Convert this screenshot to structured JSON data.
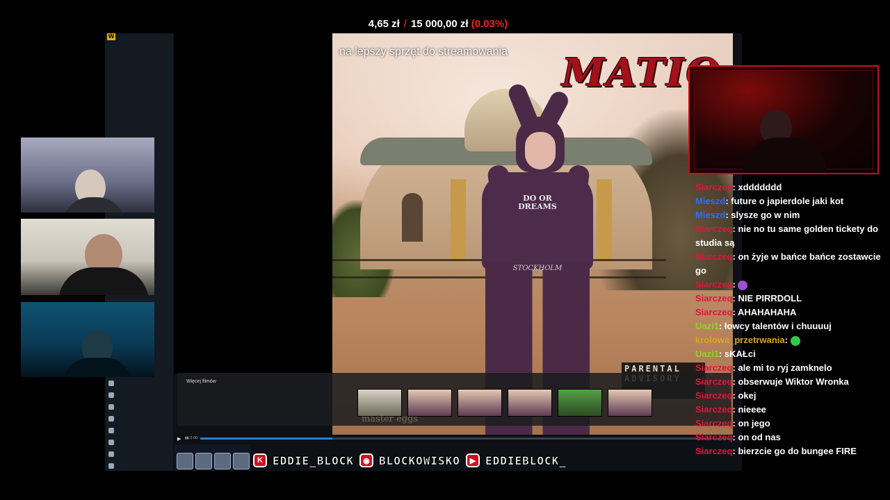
{
  "goal": {
    "current": "4,65 zł",
    "separator": "/",
    "target": "15 000,00 zł",
    "percent": "(0.03%)",
    "progress_fraction": 0.0003
  },
  "video": {
    "caption": "na lepszy sprzęt do streamowania",
    "logo_text": "MATIO",
    "shirt_text": "DO OR DREAMS",
    "pants_text": "STOCKHOLM",
    "advisory_text": "PARENTAL ADVISORY"
  },
  "youtube": {
    "more_videos_title": "Więcej filmów",
    "master_eggs": "master eggs",
    "progress_fraction": 0.248,
    "time_text": "▮▮ 0:00"
  },
  "chat": {
    "messages": [
      {
        "user": "Siarczeq",
        "color": "#e0153a",
        "text": "xddddddd"
      },
      {
        "user": "Mieszd",
        "color": "#2f6bff",
        "text": "future o japierdole jaki kot"
      },
      {
        "user": "Mieszd",
        "color": "#2f6bff",
        "text": "slysze go w nim"
      },
      {
        "user": "Siarczeq",
        "color": "#e0153a",
        "text": "nie no tu same golden tickety do studia są"
      },
      {
        "user": "Siarczeq",
        "color": "#e0153a",
        "text": "on żyje w bańce bańce zostawcie go"
      },
      {
        "user": "Siarczeq",
        "color": "#e0153a",
        "text": "",
        "emote": "purple"
      },
      {
        "user": "Siarczeq",
        "color": "#e0153a",
        "text": "NIE PIRRDOLL"
      },
      {
        "user": "Siarczeq",
        "color": "#e0153a",
        "text": "AHAHAHAHA"
      },
      {
        "user": "Uazi1",
        "color": "#9acd32",
        "text": "łowcy talentów i chuuuuj"
      },
      {
        "user": "krolowa_przetrwania",
        "color": "#daa520",
        "text": "",
        "emote": "green"
      },
      {
        "user": "Uazi1",
        "color": "#9acd32",
        "text": "sKAŁci"
      },
      {
        "user": "Siarczeq",
        "color": "#e0153a",
        "text": "ale mi to ryj zamknelo"
      },
      {
        "user": "Siarczeq",
        "color": "#e0153a",
        "text": "obserwuje Wiktor Wronka"
      },
      {
        "user": "Siarczeq",
        "color": "#e0153a",
        "text": "okej"
      },
      {
        "user": "Siarczeq",
        "color": "#e0153a",
        "text": "nieeee"
      },
      {
        "user": "Siarczeq",
        "color": "#e0153a",
        "text": "on jego"
      },
      {
        "user": "Siarczeq",
        "color": "#e0153a",
        "text": "on od nas"
      },
      {
        "user": "Siarczeq",
        "color": "#e0153a",
        "text": "bierzcie go do bungee FIRE"
      }
    ]
  },
  "socials": [
    {
      "icon": "kick-icon",
      "glyph": "K",
      "label": "EDDIE_BLOCK"
    },
    {
      "icon": "discord-icon",
      "glyph": "◉",
      "label": "BLOCKOWISKO"
    },
    {
      "icon": "youtube-icon",
      "glyph": "▶",
      "label": "EDDIEBLOCK_"
    }
  ],
  "colors": {
    "accent_red": "#d30f1f",
    "goal_percent": "#e22222",
    "progress_blue": "#2a7fd3"
  }
}
